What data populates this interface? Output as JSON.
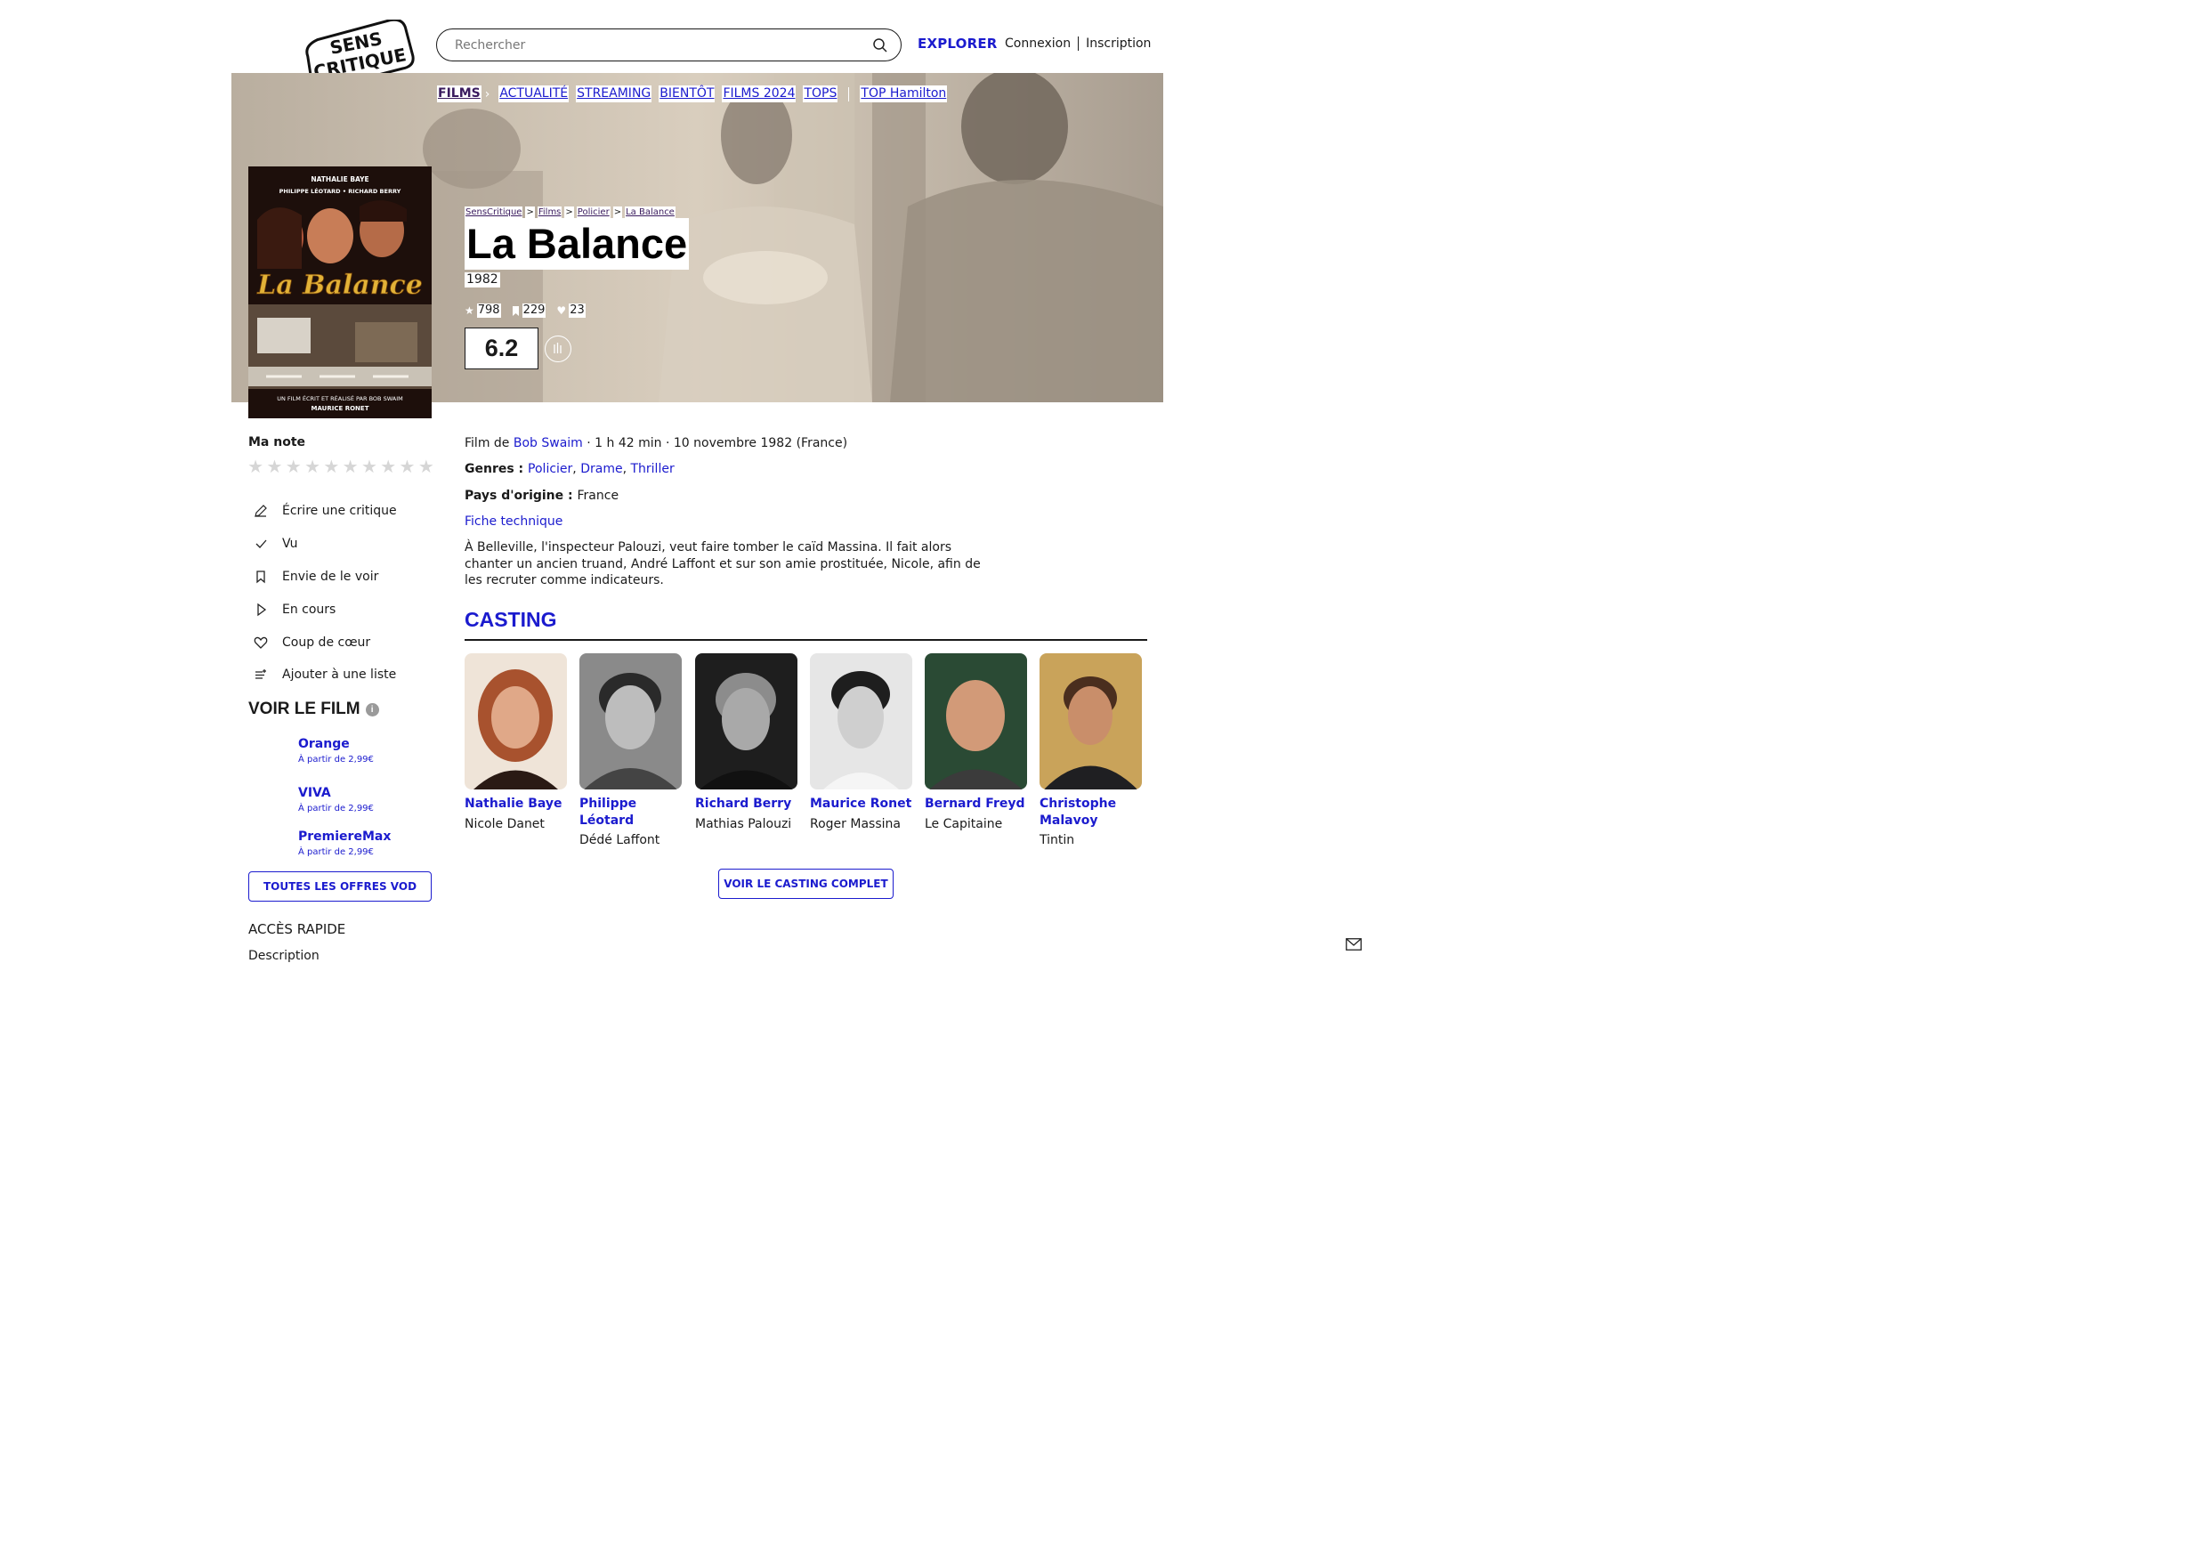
{
  "header": {
    "logo_line1": "SENS",
    "logo_line2": "CRITIQUE",
    "search_placeholder": "Rechercher",
    "explorer": "EXPLORER",
    "login": "Connexion",
    "signup": "Inscription"
  },
  "nav": {
    "items": [
      "FILMS",
      "ACTUALITÉ",
      "STREAMING",
      "BIENTÔT",
      "FILMS 2024",
      "TOPS",
      "TOP Hamilton"
    ]
  },
  "poster": {
    "actors_line1": "NATHALIE BAYE",
    "actors_line2": "PHILIPPE LÉOTARD  •  RICHARD BERRY",
    "title_script": "La Balance",
    "credit_line1": "UN FILM ÉCRIT ET RÉALISÉ PAR BOB SWAIM",
    "credit_line2": "MAURICE RONET"
  },
  "breadcrumb": [
    "SensCritique",
    "Films",
    "Policier",
    "La Balance"
  ],
  "movie": {
    "title": "La Balance",
    "year": "1982",
    "ratings_count": "798",
    "wishlist_count": "229",
    "favorites_count": "23",
    "score": "6.2",
    "film_de_label": "Film de ",
    "director": "Bob Swaim",
    "details": " · 1 h 42 min · 10 novembre 1982 (France)",
    "genres_label": "Genres : ",
    "genres": [
      "Policier",
      "Drame",
      "Thriller"
    ],
    "country_label": "Pays d'origine : ",
    "country": "France",
    "fiche": "Fiche technique",
    "synopsis": "À Belleville, l'inspecteur Palouzi, veut faire tomber le caïd Massina. Il fait alors chanter un ancien truand, André Laffont et sur son amie prostituée, Nicole, afin de les recruter comme indicateurs."
  },
  "sidebar": {
    "ma_note": "Ma note",
    "star_count": 10,
    "actions": [
      {
        "label": "Écrire une critique",
        "icon": "pencil-icon"
      },
      {
        "label": "Vu",
        "icon": "check-icon"
      },
      {
        "label": "Envie de le voir",
        "icon": "bookmark-icon"
      },
      {
        "label": "En cours",
        "icon": "play-icon"
      },
      {
        "label": "Coup de cœur",
        "icon": "heart-icon"
      },
      {
        "label": "Ajouter à une liste",
        "icon": "list-add-icon"
      }
    ],
    "voir_title": "VOIR LE FILM",
    "info_glyph": "i",
    "offers": [
      {
        "name": "Orange",
        "price": "À partir de 2,99€"
      },
      {
        "name": "VIVA",
        "price": "À partir de 2,99€"
      },
      {
        "name": "PremiereMax",
        "price": "À partir de 2,99€"
      }
    ],
    "vod_button": "TOUTES LES OFFRES VOD",
    "acces_rapide": "ACCÈS RAPIDE",
    "description": "Description"
  },
  "casting": {
    "title": "CASTING",
    "members": [
      {
        "actor": "Nathalie Baye",
        "role": "Nicole Danet"
      },
      {
        "actor": "Philippe Léotard",
        "role": "Dédé Laffont"
      },
      {
        "actor": "Richard Berry",
        "role": "Mathias Palouzi"
      },
      {
        "actor": "Maurice Ronet",
        "role": "Roger Massina"
      },
      {
        "actor": "Bernard Freyd",
        "role": "Le Capitaine"
      },
      {
        "actor": "Christophe Malavoy",
        "role": "Tintin"
      }
    ],
    "button": "VOIR LE CASTING COMPLET"
  },
  "colors": {
    "accent_blue": "#1b1bce",
    "dark_purple": "#3a1b5e",
    "text": "#1a1a1a"
  }
}
